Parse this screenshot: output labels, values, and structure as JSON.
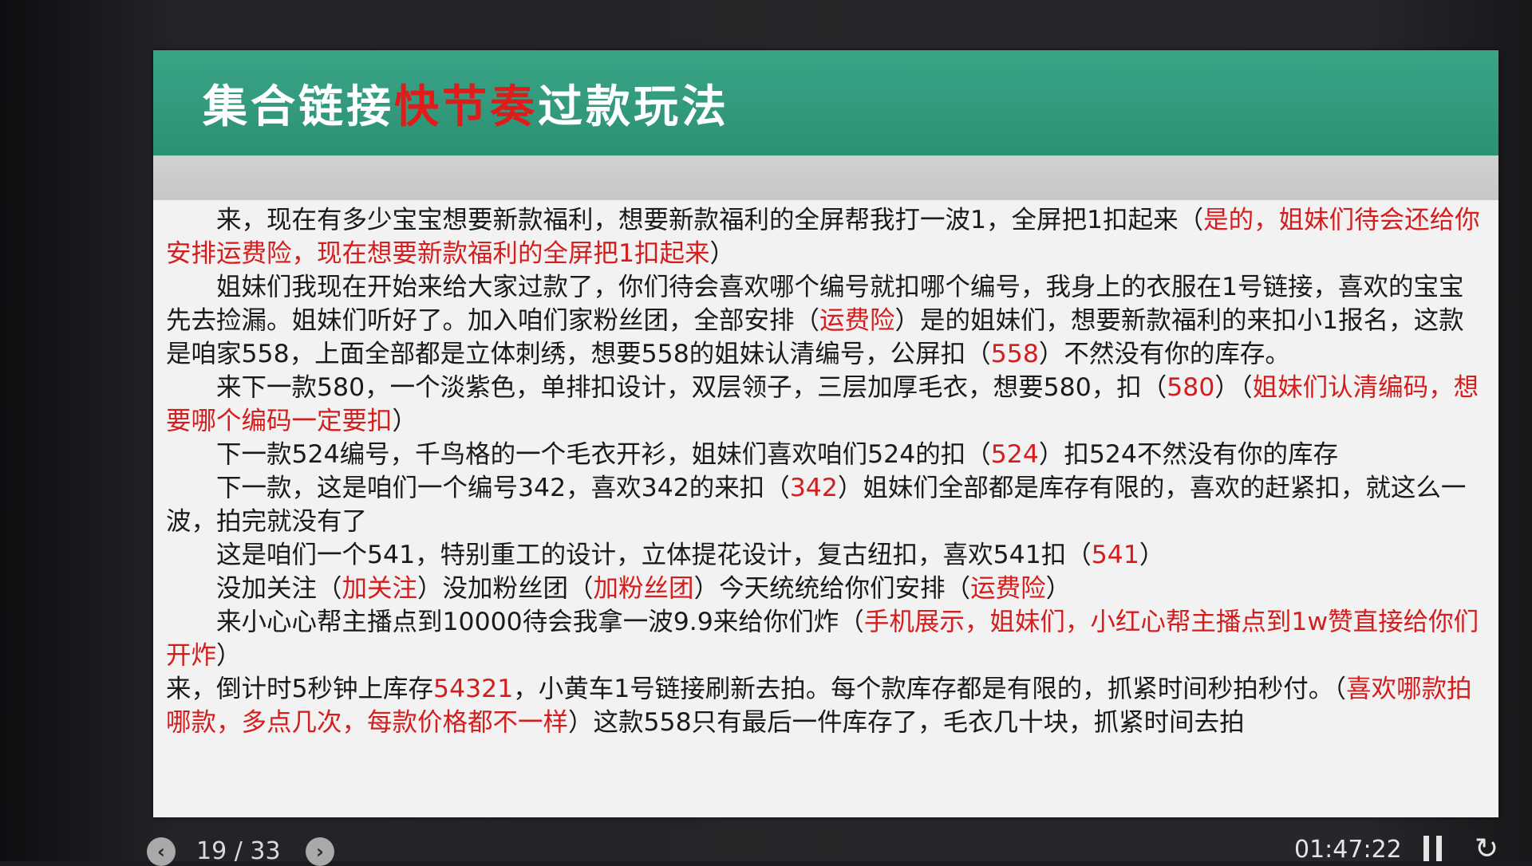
{
  "slide": {
    "title_part1": "集合链接",
    "title_highlight": "快节奏",
    "title_part2": "过款玩法",
    "paragraphs": [
      {
        "indent": true,
        "segments": [
          {
            "text": "来，现在有多少宝宝想要新款福利，想要新款福利的全屏帮我打一波1，全屏把1扣起来（",
            "red": false
          },
          {
            "text": "是的，姐妹们待会还给你安排运费险，现在想要新款福利的全屏把1扣起来",
            "red": true
          },
          {
            "text": "）",
            "red": false
          }
        ]
      },
      {
        "indent": true,
        "segments": [
          {
            "text": "姐妹们我现在开始来给大家过款了，你们待会喜欢哪个编号就扣哪个编号，我身上的衣服在1号链接，喜欢的宝宝先去捡漏。姐妹们听好了。加入咱们家粉丝团，全部安排（",
            "red": false
          },
          {
            "text": "运费险",
            "red": true
          },
          {
            "text": "）是的姐妹们，想要新款福利的来扣小1报名，这款是咱家558，上面全部都是立体刺绣，想要558的姐妹认清编号，公屏扣（",
            "red": false
          },
          {
            "text": "558",
            "red": true
          },
          {
            "text": "）不然没有你的库存。",
            "red": false
          }
        ]
      },
      {
        "indent": true,
        "segments": [
          {
            "text": "来下一款580，一个淡紫色，单排扣设计，双层领子，三层加厚毛衣，想要580，扣（",
            "red": false
          },
          {
            "text": "580",
            "red": true
          },
          {
            "text": "）（",
            "red": false
          },
          {
            "text": "姐妹们认清编码，想要哪个编码一定要扣",
            "red": true
          },
          {
            "text": "）",
            "red": false
          }
        ]
      },
      {
        "indent": true,
        "segments": [
          {
            "text": "下一款524编号，千鸟格的一个毛衣开衫，姐妹们喜欢咱们524的扣（",
            "red": false
          },
          {
            "text": "524",
            "red": true
          },
          {
            "text": "）扣524不然没有你的库存",
            "red": false
          }
        ]
      },
      {
        "indent": true,
        "segments": [
          {
            "text": "下一款，这是咱们一个编号342，喜欢342的来扣（",
            "red": false
          },
          {
            "text": "342",
            "red": true
          },
          {
            "text": "）姐妹们全部都是库存有限的，喜欢的赶紧扣，就这么一波，拍完就没有了",
            "red": false
          }
        ]
      },
      {
        "indent": true,
        "segments": [
          {
            "text": "这是咱们一个541，特别重工的设计，立体提花设计，复古纽扣，喜欢541扣（",
            "red": false
          },
          {
            "text": "541",
            "red": true
          },
          {
            "text": "）",
            "red": false
          }
        ]
      },
      {
        "indent": true,
        "segments": [
          {
            "text": "没加关注（",
            "red": false
          },
          {
            "text": "加关注",
            "red": true
          },
          {
            "text": "）没加粉丝团（",
            "red": false
          },
          {
            "text": "加粉丝团",
            "red": true
          },
          {
            "text": "）今天统统给你们安排（",
            "red": false
          },
          {
            "text": "运费险",
            "red": true
          },
          {
            "text": "）",
            "red": false
          }
        ]
      },
      {
        "indent": true,
        "segments": [
          {
            "text": "来小心心帮主播点到10000待会我拿一波9.9来给你们炸（",
            "red": false
          },
          {
            "text": "手机展示，姐妹们，小红心帮主播点到1w赞直接给你们开炸",
            "red": true
          },
          {
            "text": "）",
            "red": false
          }
        ]
      },
      {
        "indent": false,
        "segments": [
          {
            "text": "来，倒计时5秒钟上库存",
            "red": false
          },
          {
            "text": "54321",
            "red": true
          },
          {
            "text": "，小黄车1号链接刷新去拍。每个款库存都是有限的，抓紧时间秒拍秒付。（",
            "red": false
          },
          {
            "text": "喜欢哪款拍哪款，多点几次，每款价格都不一样",
            "red": true
          },
          {
            "text": "）这款558只有最后一件库存了，毛衣几十块，抓紧时间去拍",
            "red": false
          }
        ]
      }
    ]
  },
  "controls": {
    "counter": "19 / 33",
    "time": "01:47:22",
    "prev_icon": "chevron-left-icon",
    "next_icon": "chevron-right-icon",
    "pause_icon": "pause-icon",
    "replay_icon": "replay-icon"
  },
  "colors": {
    "banner": "#2f957a",
    "title_highlight": "#e21a1a",
    "text_red": "#d41e1e",
    "slide_bg": "#f1f2f1"
  }
}
